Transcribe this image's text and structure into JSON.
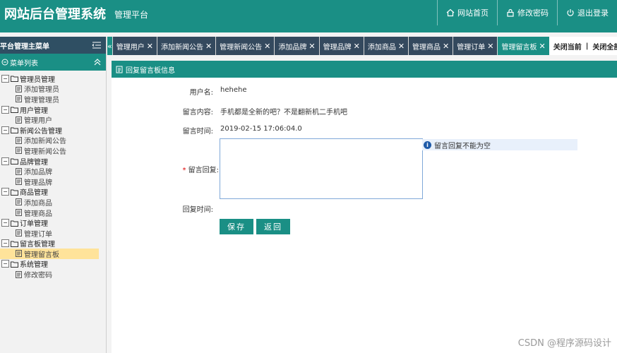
{
  "header": {
    "brand": "网站后台管理系统",
    "subtitle": "管理平台",
    "nav": [
      {
        "icon": "home-icon",
        "label": "网站首页"
      },
      {
        "icon": "lock-icon",
        "label": "修改密码"
      },
      {
        "icon": "power-icon",
        "label": "退出登录"
      }
    ]
  },
  "sidebar": {
    "title": "平台管理主菜单",
    "subtitle": "菜单列表",
    "tree": [
      {
        "label": "管理员管理",
        "children": [
          "添加管理员",
          "管理管理员"
        ]
      },
      {
        "label": "用户管理",
        "children": [
          "管理用户"
        ]
      },
      {
        "label": "新闻公告管理",
        "children": [
          "添加新闻公告",
          "管理新闻公告"
        ]
      },
      {
        "label": "品牌管理",
        "children": [
          "添加品牌",
          "管理品牌"
        ]
      },
      {
        "label": "商品管理",
        "children": [
          "添加商品",
          "管理商品"
        ]
      },
      {
        "label": "订单管理",
        "children": [
          "管理订单"
        ]
      },
      {
        "label": "留言板管理",
        "children": [
          "管理留言板"
        ]
      },
      {
        "label": "系统管理",
        "children": [
          "修改密码"
        ]
      }
    ],
    "active_item": "管理留言板"
  },
  "tabs": {
    "items": [
      "管理用户",
      "添加新闻公告",
      "管理新闻公告",
      "添加品牌",
      "管理品牌",
      "添加商品",
      "管理商品",
      "管理订单",
      "管理留言板"
    ],
    "active": "管理留言板",
    "close_current": "关闭当前",
    "separator": "|",
    "close_all": "关闭全部"
  },
  "panel": {
    "title": "回复留言板信息",
    "fields": {
      "username_label": "用户名:",
      "username_value": "hehehe",
      "content_label": "留言内容:",
      "content_value": "手机都是全新的吧？不是翻新机二手机吧",
      "time_label": "留言时间:",
      "time_value": "2019-02-15 17:06:04.0",
      "reply_required": "*",
      "reply_label": "留言回复:",
      "reply_value": "",
      "reply_time_label": "回复时间:"
    },
    "tip": "留言回复不能为空",
    "buttons": {
      "save": "保存",
      "back": "返回"
    }
  },
  "watermark": "CSDN @程序源码设计",
  "colors": {
    "accent": "#1a8f85",
    "dark": "#34495e",
    "highlight": "#ffe39a"
  }
}
